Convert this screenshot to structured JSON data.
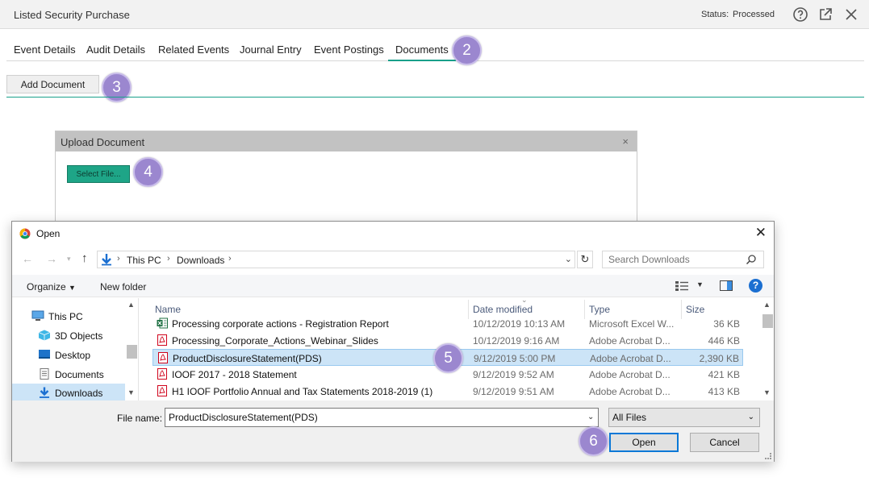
{
  "topbar": {
    "title": "Listed Security Purchase",
    "status_label": "Status:",
    "status_value": "Processed",
    "icons": [
      "help-icon",
      "popout-icon",
      "close-icon"
    ]
  },
  "tabs": [
    {
      "label": "Event Details",
      "active": false
    },
    {
      "label": "Audit Details",
      "active": false
    },
    {
      "label": "Related Events",
      "active": false
    },
    {
      "label": "Journal Entry",
      "active": false
    },
    {
      "label": "Event Postings",
      "active": false
    },
    {
      "label": "Documents",
      "active": true
    }
  ],
  "add_document_label": "Add Document",
  "upload_panel": {
    "title": "Upload Document",
    "close": "×",
    "select_file_label": "Select File..."
  },
  "markers": [
    "2",
    "3",
    "4",
    "5",
    "6"
  ],
  "dialog": {
    "title": "Open",
    "close": "✕",
    "breadcrumbs": [
      "This PC",
      "Downloads"
    ],
    "search_placeholder": "Search Downloads",
    "organize_label": "Organize",
    "new_folder_label": "New folder",
    "nav_items": [
      {
        "label": "This PC",
        "icon": "pc-icon",
        "selected": false
      },
      {
        "label": "3D Objects",
        "icon": "cube-icon",
        "selected": false
      },
      {
        "label": "Desktop",
        "icon": "desktop-icon",
        "selected": false
      },
      {
        "label": "Documents",
        "icon": "documents-icon",
        "selected": false
      },
      {
        "label": "Downloads",
        "icon": "downloads-icon",
        "selected": true
      }
    ],
    "columns": [
      "Name",
      "Date modified",
      "Type",
      "Size"
    ],
    "files": [
      {
        "name": "Processing corporate actions - Registration Report",
        "date": "10/12/2019 10:13 AM",
        "type": "Microsoft Excel W...",
        "size": "36 KB",
        "icon": "excel-icon",
        "selected": false
      },
      {
        "name": "Processing_Corporate_Actions_Webinar_Slides",
        "date": "10/12/2019 9:16 AM",
        "type": "Adobe Acrobat D...",
        "size": "446 KB",
        "icon": "pdf-icon",
        "selected": false
      },
      {
        "name": "ProductDisclosureStatement(PDS)",
        "date": "9/12/2019 5:00 PM",
        "type": "Adobe Acrobat D...",
        "size": "2,390 KB",
        "icon": "pdf-icon",
        "selected": true
      },
      {
        "name": "IOOF 2017 - 2018 Statement",
        "date": "9/12/2019 9:52 AM",
        "type": "Adobe Acrobat D...",
        "size": "421 KB",
        "icon": "pdf-icon",
        "selected": false
      },
      {
        "name": "H1 IOOF Portfolio Annual and Tax Statements 2018-2019 (1)",
        "date": "9/12/2019 9:51 AM",
        "type": "Adobe Acrobat D...",
        "size": "413 KB",
        "icon": "pdf-icon",
        "selected": false
      }
    ],
    "file_name_label": "File name:",
    "file_name_value": "ProductDisclosureStatement(PDS)",
    "file_type_value": "All Files",
    "open_label": "Open",
    "cancel_label": "Cancel"
  },
  "colors": {
    "accent_teal": "#18a08a",
    "select_file_bg": "#1ea587",
    "marker": "#9b87cf",
    "selection": "#cce4f7",
    "pdf_red": "#d0021b",
    "excel_green": "#1d6f42"
  }
}
